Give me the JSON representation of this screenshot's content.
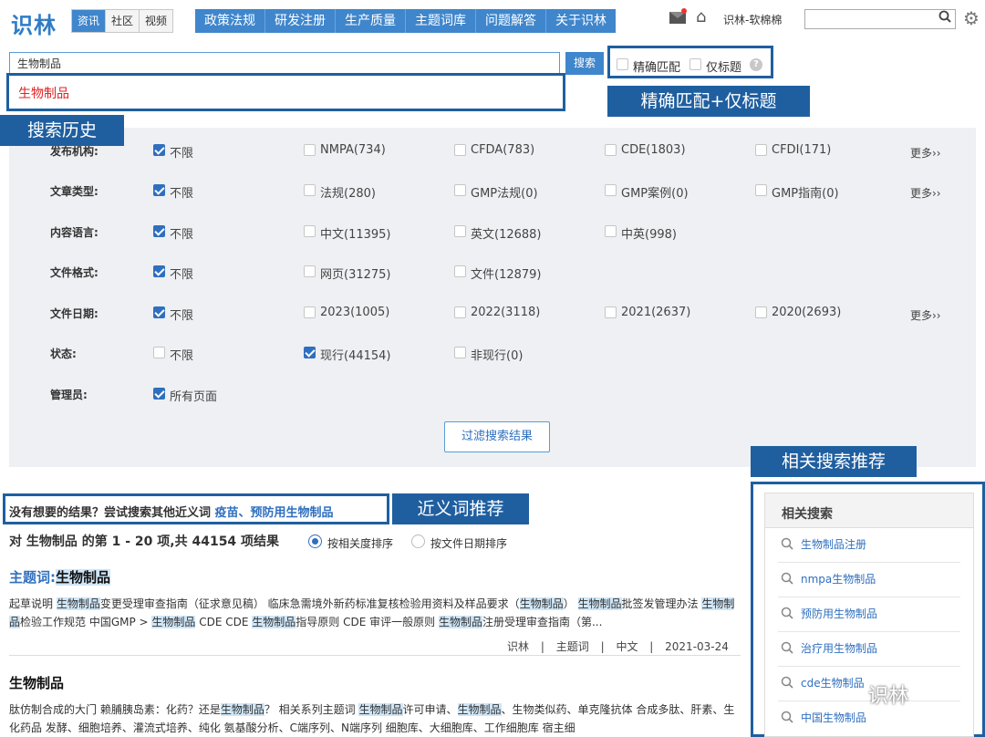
{
  "header": {
    "logo": "识林",
    "tabs": [
      "资讯",
      "社区",
      "视频"
    ],
    "nav": [
      "政策法规",
      "研发注册",
      "生产质量",
      "主题词库",
      "问题解答",
      "关于识林"
    ],
    "user": "识林-软棉棉",
    "search_placeholder": ""
  },
  "search": {
    "value": "生物制品",
    "button": "搜索",
    "exact_match": "精确匹配",
    "title_only": "仅标题",
    "help": "?",
    "history_item": "生物制品"
  },
  "callouts": {
    "history": "搜索历史",
    "exact": "精确匹配+仅标题",
    "related": "相关搜索推荐",
    "synonym": "近义词推荐"
  },
  "filters": [
    {
      "label": "发布机构:",
      "options": [
        {
          "t": "不限",
          "on": true
        },
        {
          "t": "NMPA(734)",
          "on": false
        },
        {
          "t": "CFDA(783)",
          "on": false
        },
        {
          "t": "CDE(1803)",
          "on": false
        },
        {
          "t": "CFDI(171)",
          "on": false
        }
      ],
      "more": "更多››"
    },
    {
      "label": "文章类型:",
      "options": [
        {
          "t": "不限",
          "on": true
        },
        {
          "t": "法规(280)",
          "on": false
        },
        {
          "t": "GMP法规(0)",
          "on": false
        },
        {
          "t": "GMP案例(0)",
          "on": false
        },
        {
          "t": "GMP指南(0)",
          "on": false
        }
      ],
      "more": "更多››"
    },
    {
      "label": "内容语言:",
      "options": [
        {
          "t": "不限",
          "on": true
        },
        {
          "t": "中文(11395)",
          "on": false
        },
        {
          "t": "英文(12688)",
          "on": false
        },
        {
          "t": "中英(998)",
          "on": false
        }
      ],
      "more": ""
    },
    {
      "label": "文件格式:",
      "options": [
        {
          "t": "不限",
          "on": true
        },
        {
          "t": "网页(31275)",
          "on": false
        },
        {
          "t": "文件(12879)",
          "on": false
        }
      ],
      "more": ""
    },
    {
      "label": "文件日期:",
      "options": [
        {
          "t": "不限",
          "on": true
        },
        {
          "t": "2023(1005)",
          "on": false
        },
        {
          "t": "2022(3118)",
          "on": false
        },
        {
          "t": "2021(2637)",
          "on": false
        },
        {
          "t": "2020(2693)",
          "on": false
        }
      ],
      "more": "更多››"
    },
    {
      "label": "状态:",
      "options": [
        {
          "t": "不限",
          "on": false
        },
        {
          "t": "现行(44154)",
          "on": true
        },
        {
          "t": "非现行(0)",
          "on": false
        }
      ],
      "more": ""
    },
    {
      "label": "管理员:",
      "options": [
        {
          "t": "所有页面",
          "on": true
        }
      ],
      "more": ""
    }
  ],
  "filter_button": "过滤搜索结果",
  "suggest": {
    "prefix": "没有想要的结果？尝试搜索其他近义词",
    "links": "疫苗、预防用生物制品"
  },
  "results": {
    "count_text": "对 生物制品 的第 1 - 20 项,共 44154 项结果",
    "sort_relevance": "按相关度排序",
    "sort_date": "按文件日期排序",
    "items": [
      {
        "title_prefix": "主题词:",
        "title": "生物制品",
        "snippet": "起草说明 生物制品变更受理审查指南（征求意见稿） 临床急需境外新药标准复核检验用资料及样品要求（生物制品） 生物制品批签发管理办法 生物制品检验工作规范 中国GMP > 生物制品 CDE CDE 生物制品指导原则 CDE 审评一般原则 生物制品注册受理审查指南（第...",
        "meta": [
          "识林",
          "主题词",
          "中文",
          "2021-03-24"
        ]
      },
      {
        "title_prefix": "",
        "title": "生物制品",
        "snippet": "肽仿制合成的大门 赖脯胰岛素：化药？还是生物制品？ 相关系列主题词 生物制品许可申请、生物制品、生物类似药、单克隆抗体 合成多肽、肝素、生化药品 发酵、细胞培养、灌流式培养、纯化 氨基酸分析、C端序列、N端序列 细胞库、大细胞库、工作细胞库 宿主细",
        "meta": []
      }
    ]
  },
  "related": {
    "title": "相关搜索",
    "items": [
      "生物制品注册",
      "nmpa生物制品",
      "预防用生物制品",
      "治疗用生物制品",
      "cde生物制品",
      "中国生物制品"
    ]
  },
  "watermark": "识林"
}
